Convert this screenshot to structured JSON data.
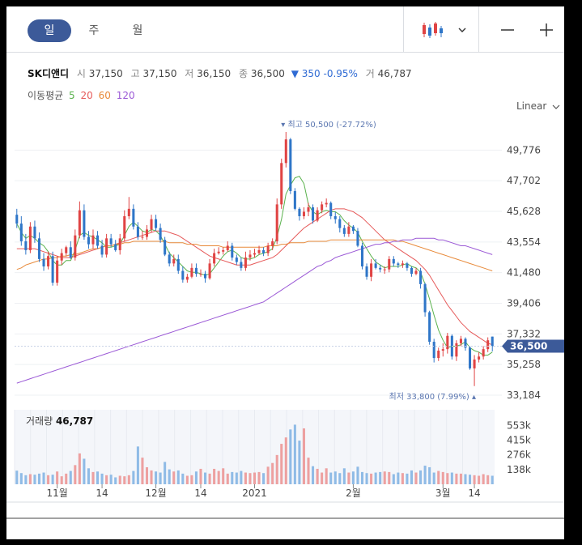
{
  "tabs": {
    "day": "일",
    "week": "주",
    "month": "월"
  },
  "stock": {
    "name": "SK디앤디",
    "open_label": "시",
    "open": "37,150",
    "high_label": "고",
    "high": "37,150",
    "low_label": "저",
    "low": "36,150",
    "close_label": "종",
    "close": "36,500",
    "change": "350",
    "change_pct": "-0.95%",
    "volume_label": "거",
    "volume": "46,787"
  },
  "ma_legend": {
    "label": "이동평균",
    "items": [
      "5",
      "20",
      "60",
      "120"
    ],
    "colors": [
      "#5ab24d",
      "#e65a5a",
      "#e88a3a",
      "#9b59d6"
    ]
  },
  "scale_mode": "Linear",
  "volume_panel": {
    "label": "거래량",
    "value": "46,787"
  },
  "colors": {
    "up": "#e04444",
    "down": "#2f76c8",
    "accent": "#3c5a99",
    "vol_up": "#eda0a0",
    "vol_down": "#8fbbe6"
  },
  "chart_data": {
    "type": "candlestick",
    "y_ticks": [
      49776,
      47702,
      45628,
      43554,
      41480,
      39406,
      37332,
      35258,
      33184
    ],
    "y_tick_labels": [
      "49,776",
      "47,702",
      "45,628",
      "43,554",
      "41,480",
      "39,406",
      "37,332",
      "35,258",
      "33,184"
    ],
    "ylim": [
      33184,
      51000
    ],
    "x_tick_labels": [
      "11월",
      "14",
      "12월",
      "14",
      "2021",
      "2월",
      "3월",
      "14"
    ],
    "current_price": "36,500",
    "max_annotation": "최고 50,500 (-27.72%)",
    "min_annotation": "최저 33,800 (7.99%)",
    "volume_ticks": [
      "553k",
      "415k",
      "276k",
      "138k"
    ],
    "close": [
      44800,
      43600,
      43000,
      44600,
      43800,
      42400,
      41900,
      42600,
      40800,
      42300,
      42800,
      43200,
      42500,
      44000,
      45700,
      43900,
      43400,
      44000,
      43300,
      42700,
      43800,
      43400,
      43000,
      43800,
      45300,
      45800,
      44600,
      43900,
      43900,
      44400,
      45100,
      44500,
      43700,
      42700,
      42100,
      42400,
      41600,
      41000,
      41200,
      41800,
      41400,
      41400,
      41100,
      42100,
      42800,
      42900,
      43000,
      43300,
      42500,
      42200,
      41800,
      42500,
      42700,
      42800,
      43000,
      42800,
      43300,
      43600,
      46100,
      48900,
      50500,
      47000,
      45800,
      45300,
      45600,
      45900,
      45000,
      45700,
      46100,
      46200,
      45300,
      45100,
      44500,
      44100,
      44600,
      44300,
      43300,
      41900,
      41200,
      42100,
      41800,
      41700,
      41700,
      42400,
      42100,
      42000,
      42100,
      41800,
      41400,
      41600,
      40700,
      38800,
      36800,
      35700,
      36200,
      36300,
      37200,
      35800,
      36700,
      37000,
      36400,
      35000,
      35600,
      35800,
      36300,
      36900,
      36500
    ],
    "open": [
      45400,
      44800,
      43600,
      43000,
      44600,
      43800,
      42400,
      41900,
      42600,
      40800,
      42300,
      42800,
      43200,
      42500,
      44000,
      45700,
      43900,
      43400,
      44000,
      43300,
      42700,
      43800,
      43400,
      43000,
      43800,
      45300,
      45800,
      44600,
      43900,
      43900,
      44400,
      45100,
      44500,
      43700,
      42700,
      42100,
      42400,
      41600,
      41000,
      41200,
      41800,
      41400,
      41400,
      41100,
      42100,
      42800,
      42900,
      43000,
      43300,
      42500,
      42200,
      41800,
      42500,
      42700,
      42800,
      43000,
      42800,
      43300,
      43600,
      46100,
      48900,
      50500,
      47000,
      45800,
      45300,
      45600,
      45900,
      45000,
      45700,
      46100,
      46200,
      45300,
      45100,
      44500,
      44100,
      44600,
      44300,
      43300,
      41900,
      41200,
      42100,
      41800,
      41700,
      41700,
      42400,
      42100,
      42000,
      42100,
      41800,
      41400,
      41600,
      40700,
      38800,
      36800,
      35700,
      36200,
      36300,
      37200,
      35800,
      36700,
      37000,
      36400,
      35000,
      35600,
      35800,
      36300,
      37150
    ],
    "high": [
      45800,
      45300,
      44100,
      44900,
      45000,
      44200,
      42800,
      42900,
      42900,
      42600,
      43100,
      43300,
      43600,
      44400,
      46300,
      46100,
      44300,
      44400,
      44300,
      43700,
      44100,
      44100,
      43700,
      44100,
      45700,
      46600,
      46100,
      44900,
      44300,
      44700,
      45400,
      45400,
      44800,
      43900,
      42900,
      42700,
      42700,
      41900,
      41400,
      42100,
      42100,
      41700,
      41600,
      42400,
      43100,
      43200,
      43200,
      43600,
      43500,
      42700,
      42500,
      42900,
      43000,
      43100,
      43300,
      43200,
      43500,
      43800,
      46500,
      49200,
      51000,
      50600,
      47200,
      45900,
      45900,
      46200,
      46100,
      45900,
      46300,
      46500,
      46300,
      45600,
      45300,
      44700,
      44900,
      44700,
      44500,
      43500,
      42100,
      42400,
      42400,
      42000,
      41900,
      42600,
      42600,
      42200,
      42300,
      42200,
      41900,
      41800,
      41800,
      40800,
      38900,
      37000,
      36400,
      36700,
      37400,
      37300,
      36900,
      37200,
      37100,
      36500,
      35900,
      36100,
      36500,
      37100,
      37150
    ],
    "low": [
      44500,
      43300,
      42700,
      42800,
      43500,
      42200,
      41600,
      41700,
      40600,
      40600,
      42000,
      42600,
      42400,
      42300,
      43800,
      43700,
      43100,
      43100,
      43100,
      42500,
      42500,
      43200,
      42900,
      42700,
      43600,
      45100,
      44400,
      43700,
      43700,
      43700,
      44200,
      44300,
      43500,
      42600,
      41900,
      41900,
      41400,
      40800,
      40800,
      41100,
      41200,
      41200,
      40800,
      41000,
      41900,
      42700,
      42700,
      42900,
      42300,
      42000,
      41600,
      41600,
      42300,
      42500,
      42700,
      42600,
      42600,
      43000,
      43400,
      45800,
      48600,
      46800,
      45700,
      45000,
      45100,
      45300,
      44800,
      44900,
      45500,
      45900,
      45100,
      44800,
      44200,
      43900,
      43900,
      44100,
      43200,
      41700,
      41000,
      40900,
      41700,
      41500,
      41400,
      41500,
      41900,
      41800,
      41800,
      41600,
      41200,
      41300,
      40400,
      38500,
      36600,
      35400,
      35500,
      35800,
      36000,
      35600,
      35500,
      36500,
      36200,
      34900,
      33800,
      35400,
      35600,
      36100,
      36150
    ],
    "ma5": [
      44800,
      44200,
      43800,
      44000,
      43800,
      43500,
      43300,
      42900,
      42300,
      42000,
      42000,
      42300,
      42300,
      43000,
      44000,
      44200,
      44000,
      43900,
      43700,
      43500,
      43200,
      43200,
      43300,
      43400,
      44000,
      44600,
      44900,
      44600,
      44300,
      44200,
      44400,
      44300,
      44000,
      43400,
      42800,
      42500,
      42200,
      41900,
      41600,
      41500,
      41500,
      41400,
      41300,
      41400,
      41800,
      42200,
      42600,
      42900,
      43000,
      42800,
      42500,
      42400,
      42400,
      42500,
      42700,
      42800,
      42900,
      43100,
      43900,
      45100,
      46800,
      47400,
      47900,
      48000,
      47500,
      46100,
      45600,
      45400,
      45600,
      45700,
      45600,
      45600,
      45400,
      45000,
      44700,
      44500,
      44200,
      43600,
      43100,
      42600,
      42200,
      42000,
      41800,
      41900,
      41900,
      41900,
      42000,
      42100,
      41900,
      41800,
      41500,
      40700,
      39700,
      38600,
      37600,
      36900,
      36400,
      36500,
      36500,
      36600,
      36800,
      36400,
      36200,
      36100,
      35900,
      35900,
      36100
    ],
    "ma20": [
      43100,
      43100,
      43100,
      43100,
      43100,
      43000,
      42900,
      42800,
      42700,
      42600,
      42500,
      42500,
      42500,
      42600,
      42700,
      42800,
      42900,
      43000,
      43100,
      43200,
      43300,
      43300,
      43400,
      43500,
      43600,
      43700,
      43800,
      43900,
      44000,
      44100,
      44200,
      44300,
      44300,
      44300,
      44200,
      44100,
      44000,
      43800,
      43600,
      43400,
      43200,
      43000,
      42800,
      42600,
      42500,
      42400,
      42300,
      42200,
      42100,
      42000,
      42000,
      42000,
      42000,
      42100,
      42200,
      42300,
      42400,
      42500,
      42700,
      43000,
      43300,
      43600,
      43900,
      44200,
      44500,
      44700,
      44900,
      45100,
      45300,
      45500,
      45700,
      45800,
      45800,
      45800,
      45700,
      45600,
      45400,
      45200,
      44900,
      44600,
      44300,
      44000,
      43700,
      43500,
      43300,
      43100,
      42900,
      42700,
      42500,
      42300,
      42000,
      41700,
      41300,
      40800,
      40300,
      39800,
      39300,
      38900,
      38500,
      38100,
      37800,
      37500,
      37300,
      37100,
      36900,
      36700,
      36600
    ],
    "ma60": [
      41700,
      41800,
      42000,
      42100,
      42200,
      42300,
      42400,
      42400,
      42500,
      42500,
      42600,
      42600,
      42700,
      42700,
      42800,
      42900,
      43000,
      43100,
      43100,
      43200,
      43300,
      43300,
      43400,
      43400,
      43500,
      43500,
      43600,
      43600,
      43600,
      43600,
      43600,
      43600,
      43600,
      43600,
      43500,
      43500,
      43500,
      43500,
      43400,
      43400,
      43400,
      43300,
      43300,
      43300,
      43300,
      43300,
      43200,
      43200,
      43200,
      43200,
      43200,
      43200,
      43200,
      43200,
      43200,
      43200,
      43300,
      43300,
      43300,
      43400,
      43400,
      43500,
      43500,
      43500,
      43500,
      43600,
      43600,
      43600,
      43600,
      43600,
      43700,
      43700,
      43700,
      43700,
      43700,
      43700,
      43700,
      43700,
      43700,
      43700,
      43700,
      43700,
      43700,
      43700,
      43700,
      43600,
      43600,
      43500,
      43400,
      43300,
      43200,
      43100,
      43000,
      42900,
      42800,
      42700,
      42600,
      42500,
      42400,
      42300,
      42200,
      42100,
      42000,
      41900,
      41800,
      41700,
      41600
    ],
    "ma120": [
      34000,
      34100,
      34200,
      34300,
      34400,
      34500,
      34600,
      34700,
      34800,
      34900,
      35000,
      35100,
      35200,
      35300,
      35400,
      35500,
      35600,
      35700,
      35800,
      35900,
      36000,
      36100,
      36200,
      36300,
      36400,
      36500,
      36600,
      36700,
      36800,
      36900,
      37000,
      37100,
      37200,
      37300,
      37400,
      37500,
      37600,
      37700,
      37800,
      37900,
      38000,
      38100,
      38200,
      38300,
      38400,
      38500,
      38600,
      38700,
      38800,
      38900,
      39000,
      39100,
      39200,
      39300,
      39400,
      39500,
      39700,
      39900,
      40100,
      40300,
      40500,
      40700,
      40900,
      41100,
      41300,
      41500,
      41700,
      41900,
      42000,
      42200,
      42300,
      42500,
      42600,
      42700,
      42800,
      42900,
      43000,
      43100,
      43200,
      43300,
      43400,
      43400,
      43500,
      43500,
      43600,
      43600,
      43700,
      43700,
      43700,
      43800,
      43800,
      43800,
      43800,
      43800,
      43700,
      43700,
      43600,
      43500,
      43400,
      43300,
      43300,
      43200,
      43100,
      43000,
      42900,
      42800,
      42700
    ],
    "volume": [
      128,
      105,
      85,
      95,
      90,
      100,
      110,
      85,
      90,
      120,
      75,
      100,
      125,
      180,
      290,
      240,
      150,
      115,
      120,
      100,
      85,
      90,
      65,
      80,
      75,
      85,
      125,
      355,
      250,
      160,
      130,
      120,
      110,
      210,
      140,
      120,
      130,
      100,
      80,
      85,
      120,
      145,
      110,
      100,
      145,
      125,
      150,
      100,
      115,
      110,
      125,
      110,
      105,
      110,
      115,
      105,
      165,
      200,
      275,
      380,
      440,
      515,
      560,
      410,
      525,
      250,
      170,
      145,
      110,
      150,
      110,
      120,
      105,
      150,
      110,
      120,
      165,
      115,
      105,
      100,
      110,
      115,
      120,
      115,
      95,
      110,
      105,
      100,
      130,
      110,
      130,
      175,
      160,
      110,
      125,
      115,
      105,
      110,
      100,
      100,
      95,
      90,
      85,
      80,
      95,
      85,
      80
    ]
  }
}
